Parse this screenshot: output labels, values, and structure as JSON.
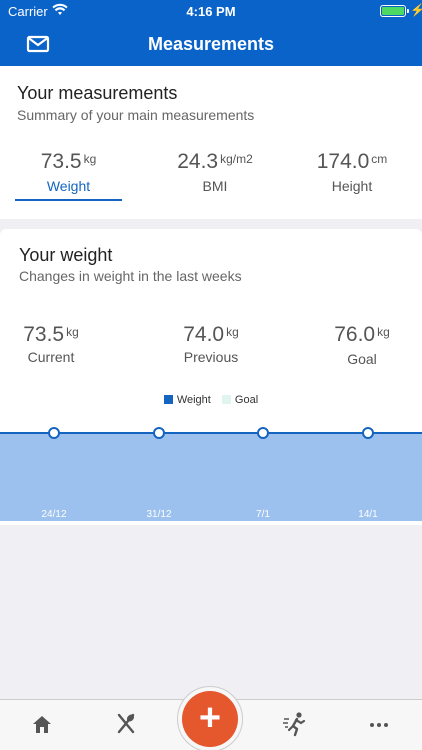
{
  "status": {
    "carrier": "Carrier",
    "time": "4:16 PM"
  },
  "nav": {
    "title": "Measurements"
  },
  "summary": {
    "title": "Your measurements",
    "subtitle": "Summary of your main measurements",
    "metrics": [
      {
        "value": "73.5",
        "unit": "kg",
        "label": "Weight"
      },
      {
        "value": "24.3",
        "unit": "kg/m2",
        "label": "BMI"
      },
      {
        "value": "174.0",
        "unit": "cm",
        "label": "Height"
      }
    ]
  },
  "weight": {
    "title": "Your weight",
    "subtitle": "Changes in weight in the last weeks",
    "metrics": [
      {
        "value": "73.5",
        "unit": "kg",
        "label": "Current"
      },
      {
        "value": "74.0",
        "unit": "kg",
        "label": "Previous"
      },
      {
        "value": "76.0",
        "unit": "kg",
        "label": "Goal"
      }
    ]
  },
  "chart_data": {
    "type": "area",
    "legend": [
      {
        "name": "Weight",
        "color": "#1565c0"
      },
      {
        "name": "Goal",
        "color": "#e0f4f0"
      }
    ],
    "x": [
      "24/12",
      "31/12",
      "7/1",
      "14/1"
    ],
    "series": [
      {
        "name": "Weight",
        "values": [
          73.5,
          73.5,
          73.5,
          73.5
        ]
      }
    ],
    "grid": false
  },
  "tabs": [
    {
      "icon": "home-icon"
    },
    {
      "icon": "utensils-icon"
    },
    {
      "icon": "add-icon",
      "label": "+"
    },
    {
      "icon": "activity-icon"
    },
    {
      "icon": "more-icon"
    }
  ],
  "colors": {
    "primary": "#0a63c9",
    "accent": "#1565c0",
    "fab": "#e5572d"
  }
}
